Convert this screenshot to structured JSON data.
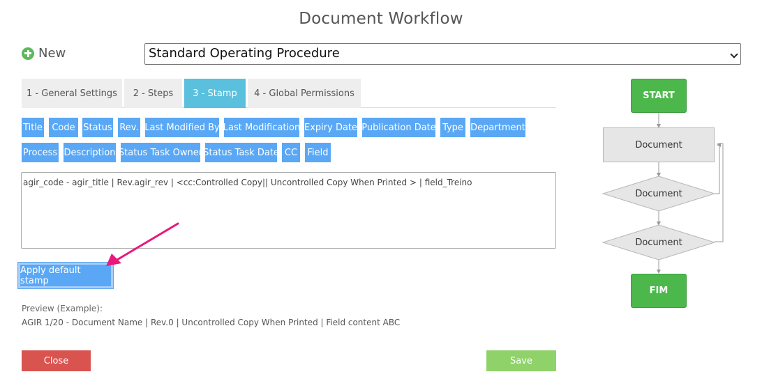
{
  "page": {
    "title": "Document Workflow"
  },
  "toolbar": {
    "new_label": "New"
  },
  "workflow_select": {
    "value": "Standard Operating Procedure"
  },
  "tabs": [
    {
      "label": "1 - General Settings",
      "active": false
    },
    {
      "label": "2 - Steps",
      "active": false
    },
    {
      "label": "3 - Stamp",
      "active": true
    },
    {
      "label": "4 - Global Permissions",
      "active": false
    }
  ],
  "fields": [
    "Title",
    "Code",
    "Status",
    "Rev.",
    "Last Modified By",
    "Last Modification",
    "Expiry Date",
    "Publication Date",
    "Type",
    "Department",
    "Process",
    "Description",
    "Status Task Owner",
    "Status Task Date",
    "CC",
    "Field"
  ],
  "stamp": {
    "value": "agir_code - agir_title | Rev.agir_rev | <cc:Controlled Copy|| Uncontrolled Copy When Printed > | field_Treino"
  },
  "apply_button": "Apply default stamp",
  "preview": {
    "label": "Preview (Example):",
    "value": "AGIR 1/20 - Document Name | Rev.0 | Uncontrolled Copy When Printed | Field content ABC"
  },
  "footer": {
    "close_label": "Close",
    "save_label": "Save"
  },
  "flow": {
    "start": "START",
    "step1": "Document",
    "step2": "Document",
    "step3": "Document",
    "end": "FIM"
  },
  "colors": {
    "tab_active": "#5bc0de",
    "field_button": "#5aa8f5",
    "close": "#d9534f",
    "save": "#8fd26a",
    "flow_green": "#4cb84c",
    "annotation_arrow": "#e8187c"
  }
}
